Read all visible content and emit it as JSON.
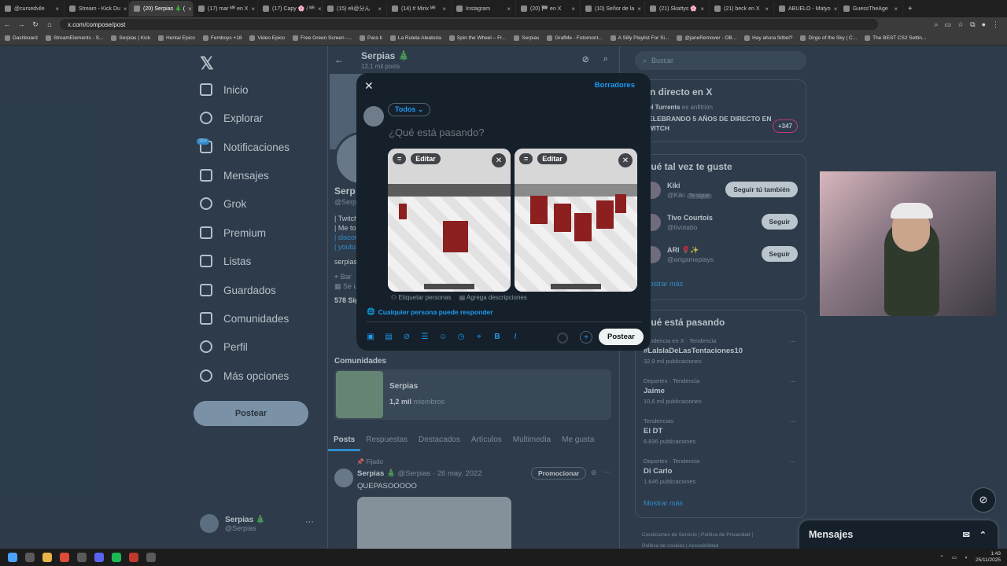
{
  "browser": {
    "tabs": [
      {
        "title": "@cursedvile"
      },
      {
        "title": "Stream - Kick Du"
      },
      {
        "title": "(20) Serpias 🎄 (",
        "active": true
      },
      {
        "title": "(17) mar ᴹᴿ en X"
      },
      {
        "title": "(17) Capy 🌸 / ᴹᴿ"
      },
      {
        "title": "(15) eli@分ん"
      },
      {
        "title": "(14) # Mirix ᴹᴿ"
      },
      {
        "title": "Instagram"
      },
      {
        "title": "(20) 🏁 en X"
      },
      {
        "title": "(10) Señor de la"
      },
      {
        "title": "(21) Skattys 🌸"
      },
      {
        "title": "(21) beck en X"
      },
      {
        "title": "ABUELO - Matyo"
      },
      {
        "title": "GuessTheAge"
      }
    ],
    "url": "x.com/compose/post",
    "bookmarks": [
      "Dashboard",
      "StreamElements - S...",
      "Serpias | Kick",
      "Hentai Epico",
      "Femboys +18",
      "Video Epico",
      "Free Green Screen -...",
      "Para ti",
      "La Ruleta Aleatoria",
      "Spin the Wheel – Fr...",
      "Serpias",
      "GrafMe - Fotomont...",
      "A Silly Playlist For Si...",
      "@janeRemover - OB...",
      "Hay ahora fútbol?",
      "Dirge of the Sky | C...",
      "The BEST CS2 Settin..."
    ]
  },
  "nav": {
    "items": [
      {
        "label": "Inicio",
        "icon": "home-icon"
      },
      {
        "label": "Explorar",
        "icon": "search-icon"
      },
      {
        "label": "Notificaciones",
        "icon": "bell-icon",
        "badge": "20+"
      },
      {
        "label": "Mensajes",
        "icon": "mail-icon"
      },
      {
        "label": "Grok",
        "icon": "grok-icon"
      },
      {
        "label": "Premium",
        "icon": "x-logo-icon"
      },
      {
        "label": "Listas",
        "icon": "list-icon"
      },
      {
        "label": "Guardados",
        "icon": "bookmark-icon"
      },
      {
        "label": "Comunidades",
        "icon": "people-icon"
      },
      {
        "label": "Perfil",
        "icon": "person-icon"
      },
      {
        "label": "Más opciones",
        "icon": "more-circle-icon"
      }
    ],
    "post_button": "Postear",
    "account": {
      "name": "Serpias 🎄",
      "handle": "@Serpias",
      "more": "···"
    }
  },
  "profile": {
    "name": "Serpias 🎄",
    "posts_count": "12,1 mil posts",
    "name_partial": "Serp",
    "handle_partial": "@Serp",
    "bio_lines": [
      "| Twitch",
      "| Me to",
      "| discor",
      "| youtu",
      "serpias"
    ],
    "location_partial": "Bar",
    "joined_partial": "Se u",
    "follow_count_partial": "578 Sig",
    "communities_title": "Comunidades",
    "community": {
      "name": "Serpias",
      "members_count": "1,2 mil",
      "members_label": "miembros"
    },
    "tabs": [
      "Posts",
      "Respuestas",
      "Destacados",
      "Artículos",
      "Multimedia",
      "Me gusta"
    ],
    "active_tab": "Posts",
    "pinned_label": "Fijado",
    "post": {
      "author": "Serpias 🎄",
      "handle": "@Serpias",
      "date": "· 26 may. 2022",
      "text": "QUEPASOOOOO",
      "promote": "Promocionar",
      "more": "···"
    }
  },
  "right": {
    "search_placeholder": "Buscar",
    "live": {
      "title": "En directo en X",
      "host": "Pol Turrents",
      "host_annotation": "es anfitrión",
      "topic": "CELEBRANDO 5 AÑOS DE DIRECTO EN TWITCH",
      "count": "+347"
    },
    "who_title": "Qué tal vez te guste",
    "who": [
      {
        "name": "Kiki",
        "handle": "@Kiki",
        "follows_you": "Te sigue",
        "button": "Seguir tú también"
      },
      {
        "name": "Tivo Courtois",
        "handle": "@tivotabo",
        "button": "Seguir"
      },
      {
        "name": "ARI 🌹✨",
        "handle": "@arigameplays",
        "button": "Seguir"
      }
    ],
    "show_more": "Mostrar más",
    "trends_title": "Qué está pasando",
    "trends": [
      {
        "context": "Tendencia en X · Tendencia",
        "name": "#LaIslaDeLasTentaciones10",
        "posts": "32,9 mil publicaciones"
      },
      {
        "context": "Deportes · Tendencia",
        "name": "Jaime",
        "posts": "10,6 mil publicaciones"
      },
      {
        "context": "Tendencias",
        "name": "El DT",
        "posts": "8.836 publicaciones"
      },
      {
        "context": "Deportes · Tendencia",
        "name": "Di Carlo",
        "posts": "1.646 publicaciones"
      }
    ],
    "trends_more": "Mostrar más",
    "footer": [
      "Condiciones de Servicio",
      "Política de Privacidad",
      "Política de cookies",
      "Accesibilidad"
    ],
    "messages_title": "Mensajes"
  },
  "compose": {
    "drafts": "Borradores",
    "audience": "Todos",
    "placeholder": "¿Qué está pasando?",
    "edit_label": "Editar",
    "tag_people": "Etiquetar personas",
    "add_descriptions": "Agrega descripciones",
    "reply_setting": "Cualquier persona puede responder",
    "post_button": "Postear"
  },
  "taskbar": {
    "time": "1:43",
    "date": "25/11/2025"
  }
}
